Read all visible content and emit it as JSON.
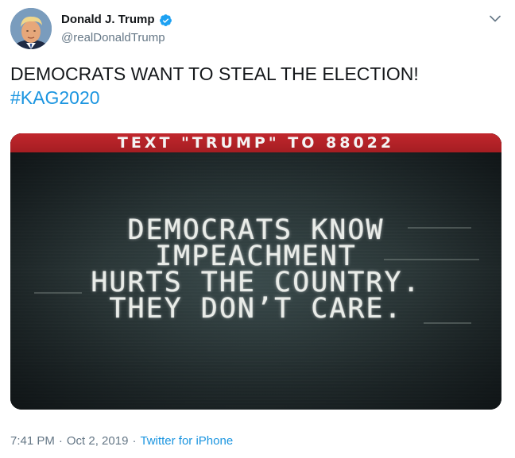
{
  "author": {
    "display_name": "Donald J. Trump",
    "handle": "@realDonaldTrump",
    "verified": true,
    "verified_color": "#1da1f2"
  },
  "tweet": {
    "text": "DEMOCRATS WANT TO STEAL THE ELECTION!",
    "hashtag": "#KAG2020"
  },
  "media": {
    "banner": "TEXT \"TRUMP\" TO 88022",
    "caption_lines": [
      "DEMOCRATS KNOW",
      "IMPEACHMENT",
      "HURTS THE COUNTRY.",
      "THEY DON’T CARE."
    ],
    "banner_color": "#c1272d"
  },
  "footer": {
    "time": "7:41 PM",
    "separator": "·",
    "date": "Oct 2, 2019",
    "separator2": "·",
    "source": "Twitter for iPhone"
  },
  "icons": {
    "verified": "verified-badge-icon",
    "menu": "chevron-down-icon"
  },
  "colors": {
    "link": "#1b95e0",
    "secondary_text": "#657786",
    "primary_text": "#14171a"
  }
}
